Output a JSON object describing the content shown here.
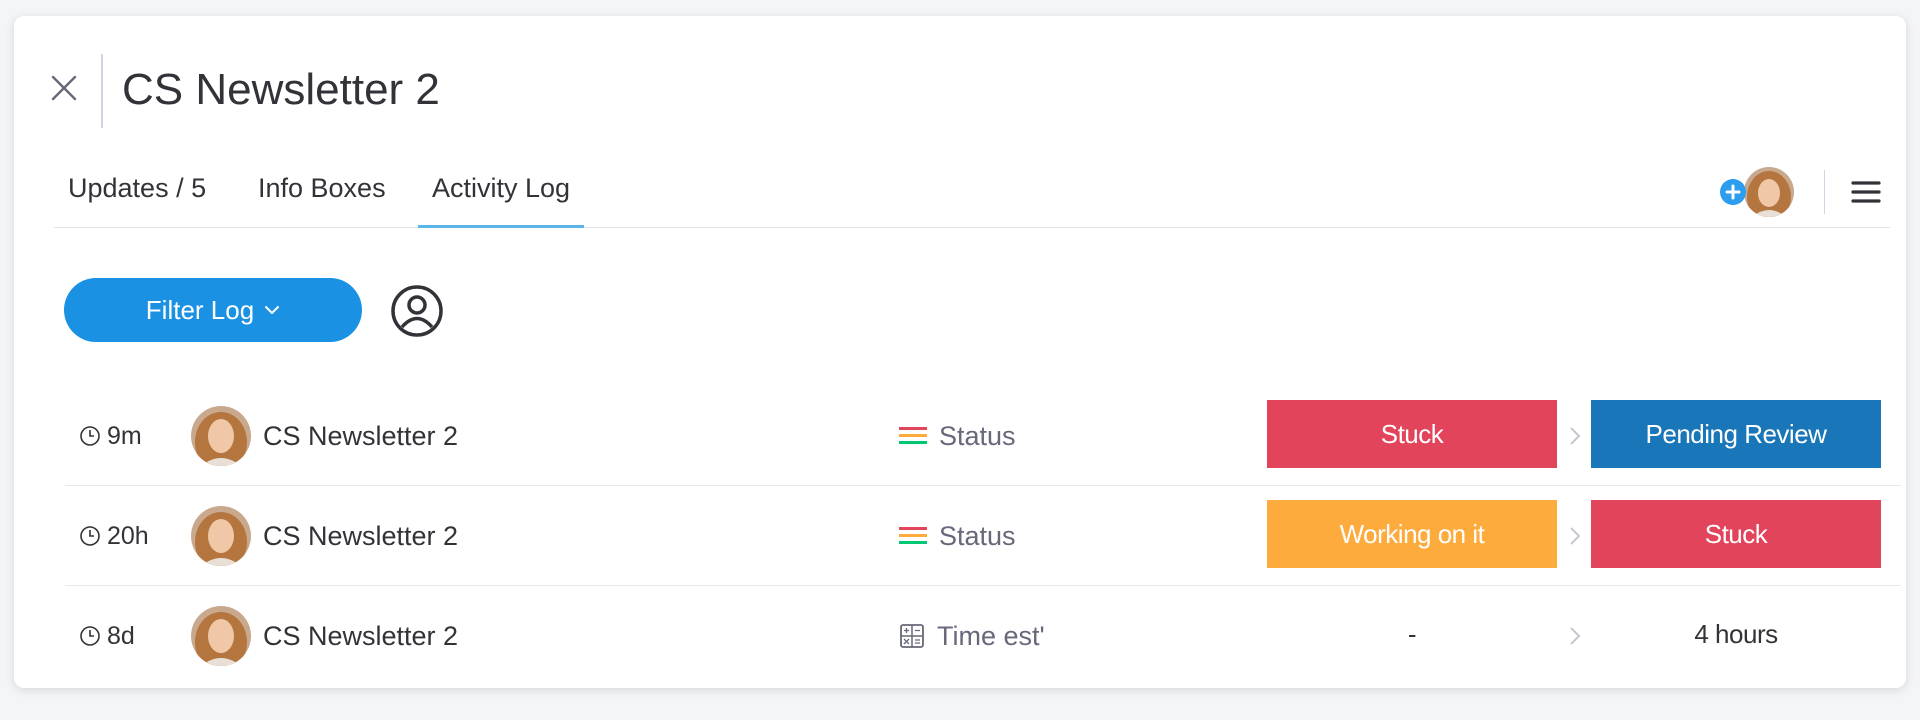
{
  "header": {
    "close_icon": "close-icon",
    "title": "CS Newsletter 2"
  },
  "tabs": [
    {
      "label": "Updates / 5",
      "active": false
    },
    {
      "label": "Info Boxes",
      "active": false
    },
    {
      "label": "Activity Log",
      "active": true
    }
  ],
  "toolbar": {
    "add_subscriber_icon": "plus-circle-icon",
    "menu_icon": "hamburger-menu-icon"
  },
  "filter": {
    "label": "Filter Log",
    "person_icon": "person-circle-icon"
  },
  "log": [
    {
      "time": "9m",
      "item": "CS Newsletter 2",
      "column": "Status",
      "column_icon": "status-column-icon",
      "old_value": "Stuck",
      "old_color": "#e2445c",
      "new_value": "Pending Review",
      "new_color": "#1976b8"
    },
    {
      "time": "20h",
      "item": "CS Newsletter 2",
      "column": "Status",
      "column_icon": "status-column-icon",
      "old_value": "Working on it",
      "old_color": "#fdab3d",
      "new_value": "Stuck",
      "new_color": "#e2445c"
    },
    {
      "time": "8d",
      "item": "CS Newsletter 2",
      "column": "Time est'",
      "column_icon": "formula-column-icon",
      "old_value": "-",
      "old_color": "",
      "new_value": "4 hours",
      "new_color": ""
    }
  ]
}
